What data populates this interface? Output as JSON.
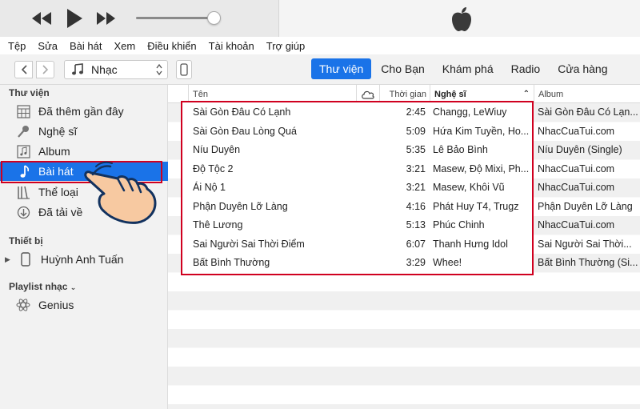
{
  "player": {
    "prev_icon": "rewind-icon",
    "play_icon": "play-icon",
    "next_icon": "fast-forward-icon",
    "volume_level": 0.9,
    "logo_icon": "apple-logo-icon"
  },
  "menu": {
    "items": [
      "Tệp",
      "Sửa",
      "Bài hát",
      "Xem",
      "Điều khiển",
      "Tài khoản",
      "Trợ giúp"
    ]
  },
  "toolbar": {
    "media_label": "Nhạc",
    "media_icon": "music-note-icon",
    "tabs": [
      {
        "label": "Thư viện",
        "active": true
      },
      {
        "label": "Cho Bạn",
        "active": false
      },
      {
        "label": "Khám phá",
        "active": false
      },
      {
        "label": "Radio",
        "active": false
      },
      {
        "label": "Cửa hàng",
        "active": false
      }
    ],
    "accent_color": "#1a73e8"
  },
  "sidebar": {
    "library_title": "Thư viện",
    "library_items": [
      {
        "label": "Đã thêm gần đây",
        "icon": "calendar-grid-icon"
      },
      {
        "label": "Nghệ sĩ",
        "icon": "microphone-icon"
      },
      {
        "label": "Album",
        "icon": "album-icon"
      },
      {
        "label": "Bài hát",
        "icon": "music-note-icon",
        "selected": true
      },
      {
        "label": "Thể loại",
        "icon": "genre-icon"
      },
      {
        "label": "Đã tải về",
        "icon": "download-icon"
      }
    ],
    "devices_title": "Thiết bị",
    "device_name": "Huỳnh Anh Tuấn",
    "playlists_title": "Playlist nhạc",
    "genius_label": "Genius",
    "highlight_color": "#d0001f"
  },
  "table": {
    "columns": {
      "name": "Tên",
      "time": "Thời gian",
      "artist": "Nghệ sĩ",
      "album": "Album"
    },
    "rows": [
      {
        "name": "Sài Gòn Đâu Có Lạnh",
        "time": "2:45",
        "artist": "Changg, LeWiuy",
        "album": "Sài Gòn Đâu Có Lạn..."
      },
      {
        "name": "Sài Gòn Đau Lòng Quá",
        "time": "5:09",
        "artist": "Hứa Kim Tuyền, Ho...",
        "album": "NhacCuaTui.com"
      },
      {
        "name": "Níu Duyên",
        "time": "5:35",
        "artist": "Lê Bảo Bình",
        "album": "Níu Duyên (Single)"
      },
      {
        "name": "Độ Tộc 2",
        "time": "3:21",
        "artist": "Masew, Độ Mixi, Ph...",
        "album": "NhacCuaTui.com"
      },
      {
        "name": "Ái Nộ 1",
        "time": "3:21",
        "artist": "Masew, Khôi Vũ",
        "album": "NhacCuaTui.com"
      },
      {
        "name": "Phận Duyên Lỡ Làng",
        "time": "4:16",
        "artist": "Phát Huy T4, Trugz",
        "album": "Phận Duyên Lỡ Làng"
      },
      {
        "name": "Thê Lương",
        "time": "5:13",
        "artist": "Phúc Chinh",
        "album": "NhacCuaTui.com"
      },
      {
        "name": "Sai Người Sai Thời Điểm",
        "time": "6:07",
        "artist": "Thanh Hưng Idol",
        "album": "Sai Người Sai Thời..."
      },
      {
        "name": "Bất Bình Thường",
        "time": "3:29",
        "artist": "Whee!",
        "album": "Bất Bình Thường (Si..."
      }
    ]
  }
}
